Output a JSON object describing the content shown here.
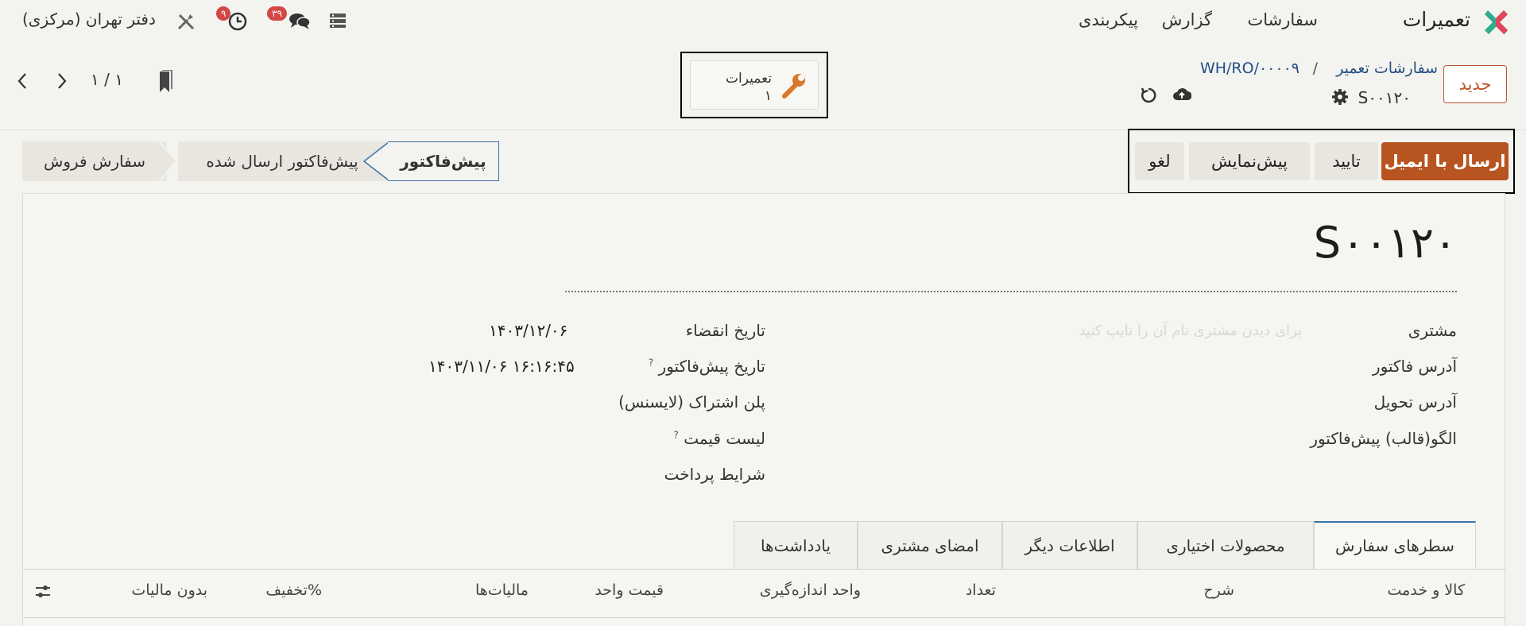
{
  "navbar": {
    "app_name": "تعمیرات",
    "menu": [
      "سفارشات",
      "گزارش",
      "پیکربندی"
    ],
    "company": "دفتر تهران (مرکزی)",
    "messages_count": "۳۹",
    "activities_count": "۹",
    "brand_colors": [
      "#2eae8e",
      "#e0455a"
    ]
  },
  "control": {
    "new_button": "جدید",
    "breadcrumb_parent": "سفارشات تعمیر",
    "breadcrumb_sep": "/",
    "breadcrumb_current": "WH/RO/۰۰۰۰۹",
    "record_name": "S۰۰۱۲۰",
    "pager": "۱ / ۱",
    "smart_button": {
      "label": "تعمیرات",
      "value": "۱"
    }
  },
  "actions": {
    "send_email": "ارسال با ایمیل",
    "confirm": "تایید",
    "preview": "پیش‌نمایش",
    "cancel": "لغو",
    "primary_color": "#b8541f"
  },
  "statusbar": {
    "stages": [
      "پیش‌فاکتور",
      "پیش‌فاکتور ارسال شده",
      "سفارش فروش"
    ],
    "active_index": 0
  },
  "form": {
    "title": "S۰۰۱۲۰",
    "customer_label": "مشتری",
    "customer_placeholder": "برای دیدن مشتری نام آن را تایپ کنید",
    "invoice_address_label": "آدرس فاکتور",
    "delivery_address_label": "آدرس تحویل",
    "template_label": "الگو(قالب) پیش‌فاکتور",
    "expiration_label": "تاریخ انقضاء",
    "expiration_value": "۱۴۰۳/۱۲/۰۶",
    "quotation_date_label": "تاریخ پیش‌فاکتور",
    "quotation_date_value": "۱۴۰۳/۱۱/۰۶ ۱۶:۱۶:۴۵",
    "subscription_label": "پلن اشتراک (لایسنس)",
    "pricelist_label": "لیست قیمت",
    "payment_terms_label": "شرایط پرداخت",
    "help_mark": "?"
  },
  "tabs": [
    "سطرهای سفارش",
    "محصولات اختیاری",
    "اطلاعات دیگر",
    "امضای مشتری",
    "یادداشت‌ها"
  ],
  "table_headers": [
    "کالا و خدمت",
    "شرح",
    "تعداد",
    "واحد اندازه‌گیری",
    "قیمت واحد",
    "مالیات‌ها",
    "تخفیف%",
    "بدون مالیات"
  ]
}
